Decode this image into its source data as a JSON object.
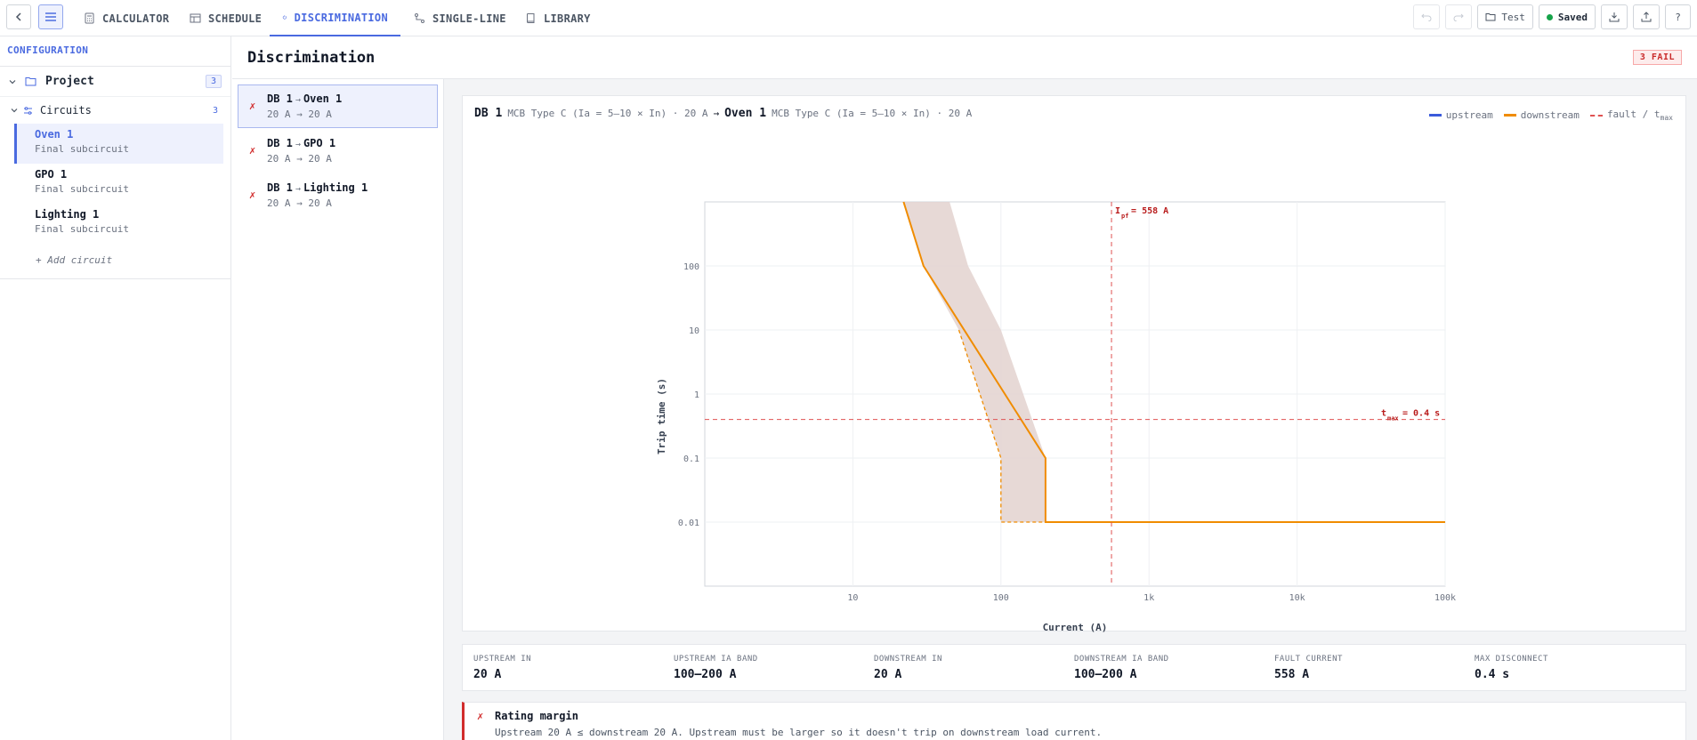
{
  "nav": {
    "tabs": [
      {
        "label": "CALCULATOR",
        "icon": "calculator-icon"
      },
      {
        "label": "SCHEDULE",
        "icon": "table-icon"
      },
      {
        "label": "DISCRIMINATION",
        "icon": "power-icon"
      },
      {
        "label": "SINGLE-LINE",
        "icon": "diagram-icon"
      },
      {
        "label": "LIBRARY",
        "icon": "book-icon"
      }
    ],
    "active_tab": "DISCRIMINATION",
    "project_button": "Test",
    "save_status": "Saved",
    "help": "?"
  },
  "sidebar": {
    "heading": "CONFIGURATION",
    "project": {
      "label": "Project",
      "count": "3"
    },
    "group": {
      "label": "Circuits",
      "count": "3"
    },
    "circuits": [
      {
        "name": "Oven 1",
        "sub": "Final subcircuit",
        "active": true
      },
      {
        "name": "GPO 1",
        "sub": "Final subcircuit",
        "active": false
      },
      {
        "name": "Lighting 1",
        "sub": "Final subcircuit",
        "active": false
      }
    ],
    "add_label": "+ Add circuit"
  },
  "main": {
    "title": "Discrimination",
    "badge": "3 FAIL",
    "pairs": [
      {
        "status": "✗",
        "upstream": "DB 1",
        "arrow": "→",
        "downstream": "Oven 1",
        "ratings": "20 A → 20 A",
        "active": true
      },
      {
        "status": "✗",
        "upstream": "DB 1",
        "arrow": "→",
        "downstream": "GPO 1",
        "ratings": "20 A → 20 A",
        "active": false
      },
      {
        "status": "✗",
        "upstream": "DB 1",
        "arrow": "→",
        "downstream": "Lighting 1",
        "ratings": "20 A → 20 A",
        "active": false
      }
    ],
    "chart_header": {
      "upstream_name": "DB 1",
      "upstream_desc": "MCB Type C (Ia = 5–10 × In) · 20 A",
      "arrow": "→",
      "downstream_name": "Oven 1",
      "downstream_desc": "MCB Type C (Ia = 5–10 × In) · 20 A"
    },
    "legend": {
      "upstream": "upstream",
      "downstream": "downstream",
      "fault": "fault / t",
      "fault_sub": "max"
    },
    "stats": [
      {
        "label": "UPSTREAM IN",
        "value": "20 A"
      },
      {
        "label": "UPSTREAM IA BAND",
        "value": "100–200 A"
      },
      {
        "label": "DOWNSTREAM IN",
        "value": "20 A"
      },
      {
        "label": "DOWNSTREAM IA BAND",
        "value": "100–200 A"
      },
      {
        "label": "FAULT CURRENT",
        "value": "558 A"
      },
      {
        "label": "MAX DISCONNECT",
        "value": "0.4 s"
      }
    ],
    "alert": {
      "icon": "✗",
      "title": "Rating margin",
      "desc": "Upstream 20 A ≤ downstream 20 A. Upstream must be larger so it doesn't trip on downstream load current."
    }
  },
  "colors": {
    "accent": "#4a6ae0",
    "upstream": "#3b5bdb",
    "downstream": "#f08c00",
    "fault": "#e05252",
    "band": "#e3d2cf"
  },
  "chart_data": {
    "type": "line",
    "xlabel": "Current (A)",
    "ylabel": "Trip time (s)",
    "x_scale": "log",
    "y_scale": "log",
    "xlim": [
      1,
      100000
    ],
    "ylim": [
      0.001,
      1000
    ],
    "x_ticks": [
      {
        "v": 10,
        "label": "10"
      },
      {
        "v": 100,
        "label": "100"
      },
      {
        "v": 1000,
        "label": "1k"
      },
      {
        "v": 10000,
        "label": "10k"
      },
      {
        "v": 100000,
        "label": "100k"
      }
    ],
    "y_ticks": [
      {
        "v": 0.01,
        "label": "0.01"
      },
      {
        "v": 0.1,
        "label": "0.1"
      },
      {
        "v": 1,
        "label": "1"
      },
      {
        "v": 10,
        "label": "10"
      },
      {
        "v": 100,
        "label": "100"
      }
    ],
    "grid": true,
    "series": [
      {
        "name": "downstream",
        "max_curve": [
          [
            22,
            1000
          ],
          [
            30,
            100
          ],
          [
            200,
            0.1
          ],
          [
            200,
            0.01
          ],
          [
            100000,
            0.01
          ]
        ],
        "min_curve": [
          [
            52,
            10
          ],
          [
            100,
            0.1
          ],
          [
            100,
            0.01
          ],
          [
            200,
            0.01
          ]
        ],
        "band": [
          [
            22,
            1000
          ],
          [
            45,
            1000
          ],
          [
            60,
            100
          ],
          [
            100,
            10
          ],
          [
            200,
            0.1
          ],
          [
            200,
            0.01
          ],
          [
            100,
            0.01
          ],
          [
            100,
            0.1
          ],
          [
            52,
            10
          ],
          [
            30,
            100
          ]
        ]
      }
    ],
    "fault_current": {
      "value": 558,
      "label": "I",
      "sub": "pf",
      "suffix": " = 558 A"
    },
    "t_max": {
      "value": 0.4,
      "label": "t",
      "sub": "max",
      "suffix": " = 0.4 s"
    }
  }
}
